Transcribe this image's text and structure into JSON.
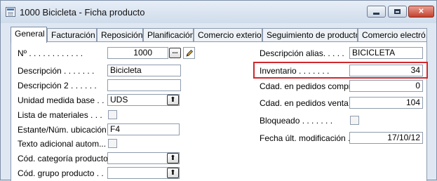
{
  "window": {
    "title": "1000 Bicicleta - Ficha producto",
    "icons": {
      "app": "form-icon",
      "minimize": "minimize-icon",
      "maximize": "maximize-icon",
      "close": "close-icon"
    },
    "close_glyph": "✕"
  },
  "tabs": [
    {
      "label": "General",
      "active": true
    },
    {
      "label": "Facturación"
    },
    {
      "label": "Reposición"
    },
    {
      "label": "Planificación"
    },
    {
      "label": "Comercio exterior"
    },
    {
      "label": "Seguimiento de productos"
    },
    {
      "label": "Comercio electró..."
    }
  ],
  "left_fields": {
    "no": {
      "label": "Nº . . . . . . . . . . . .",
      "value": "1000",
      "assist_glyph": "...",
      "edit_icon": "pencil-icon"
    },
    "descripcion": {
      "label": "Descripción . . . . . . .",
      "value": "Bicicleta"
    },
    "descripcion2": {
      "label": "Descripción 2 . . . . . .",
      "value": ""
    },
    "unidad_medida_base": {
      "label": "Unidad medida base . .",
      "value": "UDS",
      "lookup_glyph": "⬆"
    },
    "lista_materiales": {
      "label": "Lista de materiales . . .",
      "checked": false
    },
    "estante": {
      "label": "Estante/Núm. ubicación . .",
      "value": "F4"
    },
    "texto_adicional": {
      "label": "Texto adicional autom...",
      "checked": false
    },
    "cod_categoria": {
      "label": "Cód. categoría producto. .",
      "value": "",
      "lookup_glyph": "⬆"
    },
    "cod_grupo": {
      "label": "Cód. grupo producto . .",
      "value": "",
      "lookup_glyph": "⬆"
    }
  },
  "right_fields": {
    "descripcion_alias": {
      "label": "Descripción alias. . . . .",
      "value": "BICICLETA"
    },
    "inventario": {
      "label": "Inventario . . . . . . .",
      "value": "34",
      "highlight_color": "#d0282c"
    },
    "cdad_pedidos_compra": {
      "label": "Cdad. en pedidos compra .",
      "value": "0"
    },
    "cdad_pedidos_venta": {
      "label": "Cdad. en pedidos venta . .",
      "value": "104"
    },
    "bloqueado": {
      "label": "Bloqueado . . . . . . .",
      "checked": false
    },
    "fecha_ult_mod": {
      "label": "Fecha últ. modificación . .",
      "value": "17/10/12"
    }
  }
}
